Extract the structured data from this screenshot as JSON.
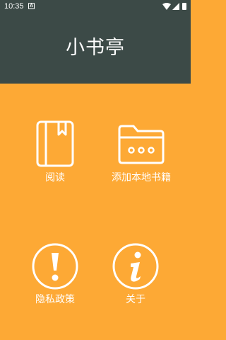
{
  "status_bar": {
    "time": "10:35",
    "notification_icon": "a-badge-icon",
    "icons": [
      "wifi-icon",
      "signal-icon",
      "battery-icon"
    ]
  },
  "app": {
    "title": "小书亭"
  },
  "menu": {
    "items": [
      {
        "label": "阅读",
        "icon": "book-icon"
      },
      {
        "label": "添加本地书籍",
        "icon": "folder-icon"
      },
      {
        "label": "隐私政策",
        "icon": "exclamation-icon"
      },
      {
        "label": "关于",
        "icon": "info-icon"
      }
    ]
  },
  "colors": {
    "header": "#3C4A47",
    "background": "#FDA935",
    "foreground": "#FFFFFF"
  }
}
